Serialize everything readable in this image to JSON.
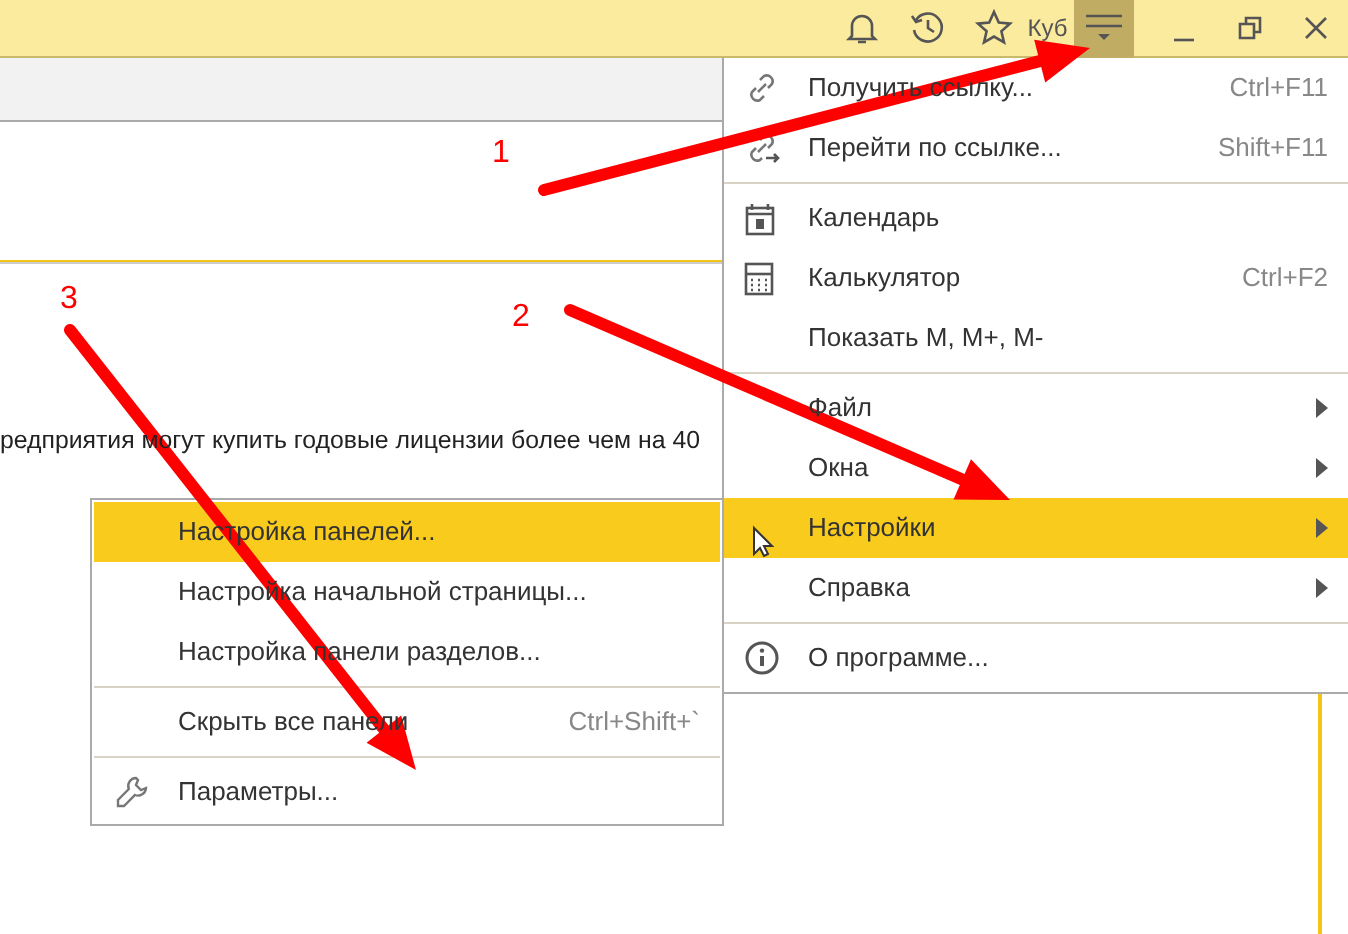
{
  "title_bar": {
    "user_label": "Куб"
  },
  "body_text": "редприятия могут купить годовые лицензии более чем на 40",
  "main_menu": {
    "groups": [
      [
        {
          "kind": "link",
          "label": "Получить ссылку...",
          "shortcut": "Ctrl+F11",
          "submenu": false,
          "selected": false
        },
        {
          "kind": "link-go",
          "label": "Перейти по ссылке...",
          "shortcut": "Shift+F11",
          "submenu": false,
          "selected": false
        }
      ],
      [
        {
          "kind": "calendar",
          "label": "Календарь",
          "submenu": false,
          "selected": false
        },
        {
          "kind": "calculator",
          "label": "Калькулятор",
          "shortcut": "Ctrl+F2",
          "submenu": false,
          "selected": false
        },
        {
          "kind": "plain",
          "label": "Показать M, M+, M-",
          "submenu": false,
          "selected": false
        }
      ],
      [
        {
          "kind": "plain",
          "label": "Файл",
          "submenu": true,
          "selected": false
        },
        {
          "kind": "plain",
          "label": "Окна",
          "submenu": true,
          "selected": false
        },
        {
          "kind": "plain",
          "label": "Настройки",
          "submenu": true,
          "selected": true
        },
        {
          "kind": "plain",
          "label": "Справка",
          "submenu": true,
          "selected": false
        }
      ],
      [
        {
          "kind": "info",
          "label": "О программе...",
          "submenu": false,
          "selected": false
        }
      ]
    ]
  },
  "sub_menu": {
    "groups": [
      [
        {
          "kind": "plain",
          "label": "Настройка панелей...",
          "selected": true
        },
        {
          "kind": "plain",
          "label": "Настройка начальной страницы...",
          "selected": false
        },
        {
          "kind": "plain",
          "label": "Настройка панели разделов...",
          "selected": false
        }
      ],
      [
        {
          "kind": "plain",
          "label": "Скрыть все панели",
          "shortcut": "Ctrl+Shift+`",
          "selected": false
        }
      ],
      [
        {
          "kind": "wrench",
          "label": "Параметры...",
          "selected": false
        }
      ]
    ]
  },
  "annotations": [
    {
      "number": "1"
    },
    {
      "number": "2"
    },
    {
      "number": "3"
    }
  ]
}
